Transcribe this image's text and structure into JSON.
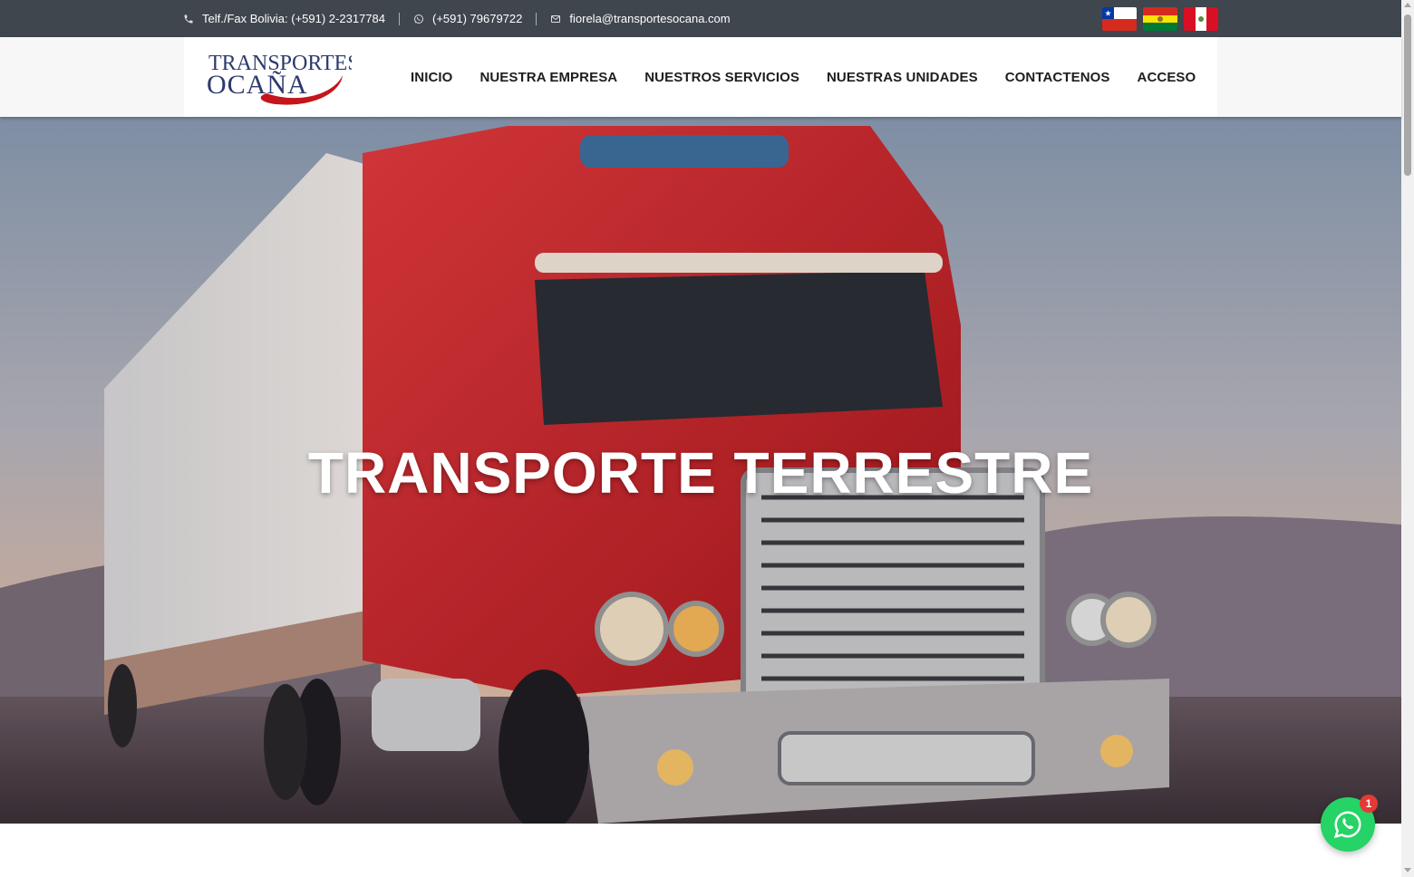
{
  "topbar": {
    "phone": "Telf./Fax Bolivia: (+591) 2-2317784",
    "whatsapp": "(+591) 79679722",
    "email": "fiorela@transportesocana.com",
    "flags": [
      "chile-flag",
      "bolivia-flag",
      "peru-flag"
    ]
  },
  "logo": {
    "line1": "TRANSPORTES",
    "line2": "OCAÑA"
  },
  "nav": {
    "items": [
      "INICIO",
      "NUESTRA EMPRESA",
      "NUESTROS SERVICIOS",
      "NUESTRAS UNIDADES",
      "CONTACTENOS",
      "ACCESO"
    ]
  },
  "hero": {
    "title": "TRANSPORTE TERRESTRE"
  },
  "whatsapp_widget": {
    "badge": "1"
  },
  "colors": {
    "topbar": "#3f464e",
    "logo_blue": "#2d3a6e",
    "logo_red": "#c4161c",
    "whatsapp": "#25d366",
    "badge": "#e53935"
  }
}
